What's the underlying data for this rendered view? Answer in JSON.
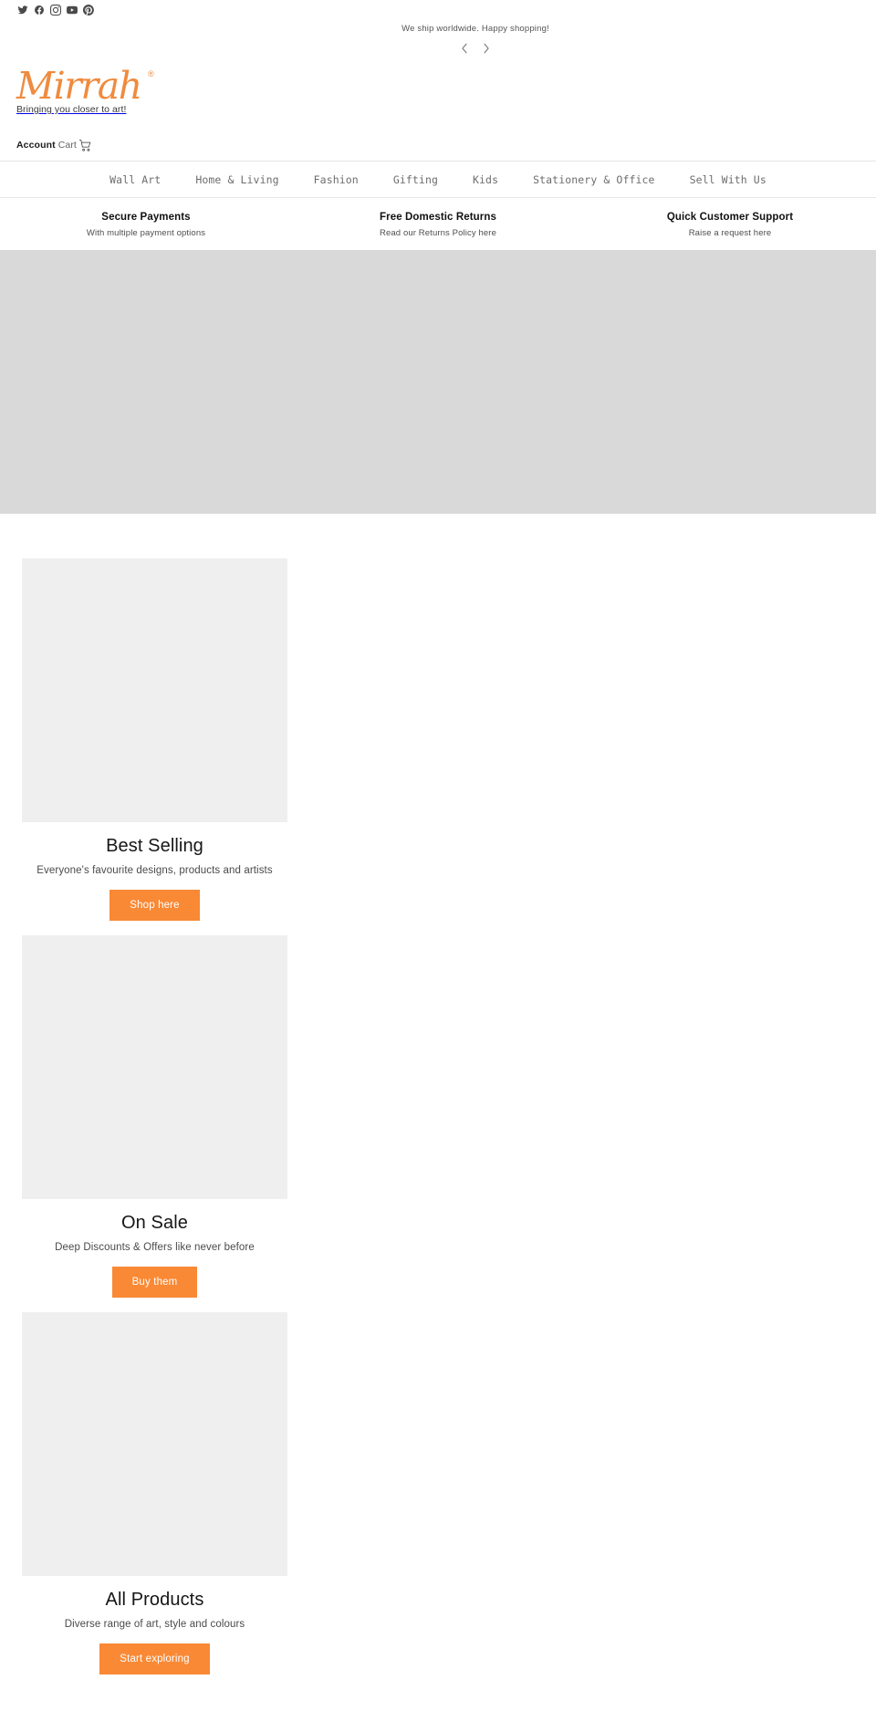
{
  "social": {
    "items": [
      {
        "name": "twitter-icon",
        "label": "Twitter"
      },
      {
        "name": "facebook-icon",
        "label": "Facebook"
      },
      {
        "name": "instagram-icon",
        "label": "Instagram"
      },
      {
        "name": "youtube-icon",
        "label": "YouTube"
      },
      {
        "name": "pinterest-icon",
        "label": "Pinterest"
      }
    ]
  },
  "announcement": {
    "text": "We ship worldwide. Happy shopping!",
    "prev_label": "Previous announcement",
    "next_label": "Next announcement"
  },
  "header": {
    "logo_text": "Mirrah",
    "logo_registered": "®",
    "tagline": "Bringing you closer to art!",
    "account_label": "Account",
    "cart_label": "Cart"
  },
  "nav": {
    "items": [
      {
        "label": "Wall Art"
      },
      {
        "label": "Home & Living"
      },
      {
        "label": "Fashion"
      },
      {
        "label": "Gifting"
      },
      {
        "label": "Kids"
      },
      {
        "label": "Stationery & Office"
      },
      {
        "label": "Sell With Us"
      }
    ]
  },
  "features": [
    {
      "title": "Secure Payments",
      "sub": "With multiple payment options"
    },
    {
      "title": "Free Domestic Returns",
      "sub": "Read our Returns Policy here"
    },
    {
      "title": "Quick Customer Support",
      "sub": "Raise a request here"
    }
  ],
  "promos": [
    {
      "title": "Best Selling",
      "sub": "Everyone's favourite designs, products and artists",
      "button": "Shop here"
    },
    {
      "title": "On Sale",
      "sub": "Deep Discounts & Offers like never before",
      "button": "Buy them"
    },
    {
      "title": "All Products",
      "sub": "Diverse range of art, style and colours",
      "button": "Start exploring"
    }
  ],
  "colors": {
    "brand_orange": "#ef8b3f",
    "button_orange": "#f98935",
    "hero_grey": "#d9d9d9",
    "card_grey": "#efefef"
  }
}
